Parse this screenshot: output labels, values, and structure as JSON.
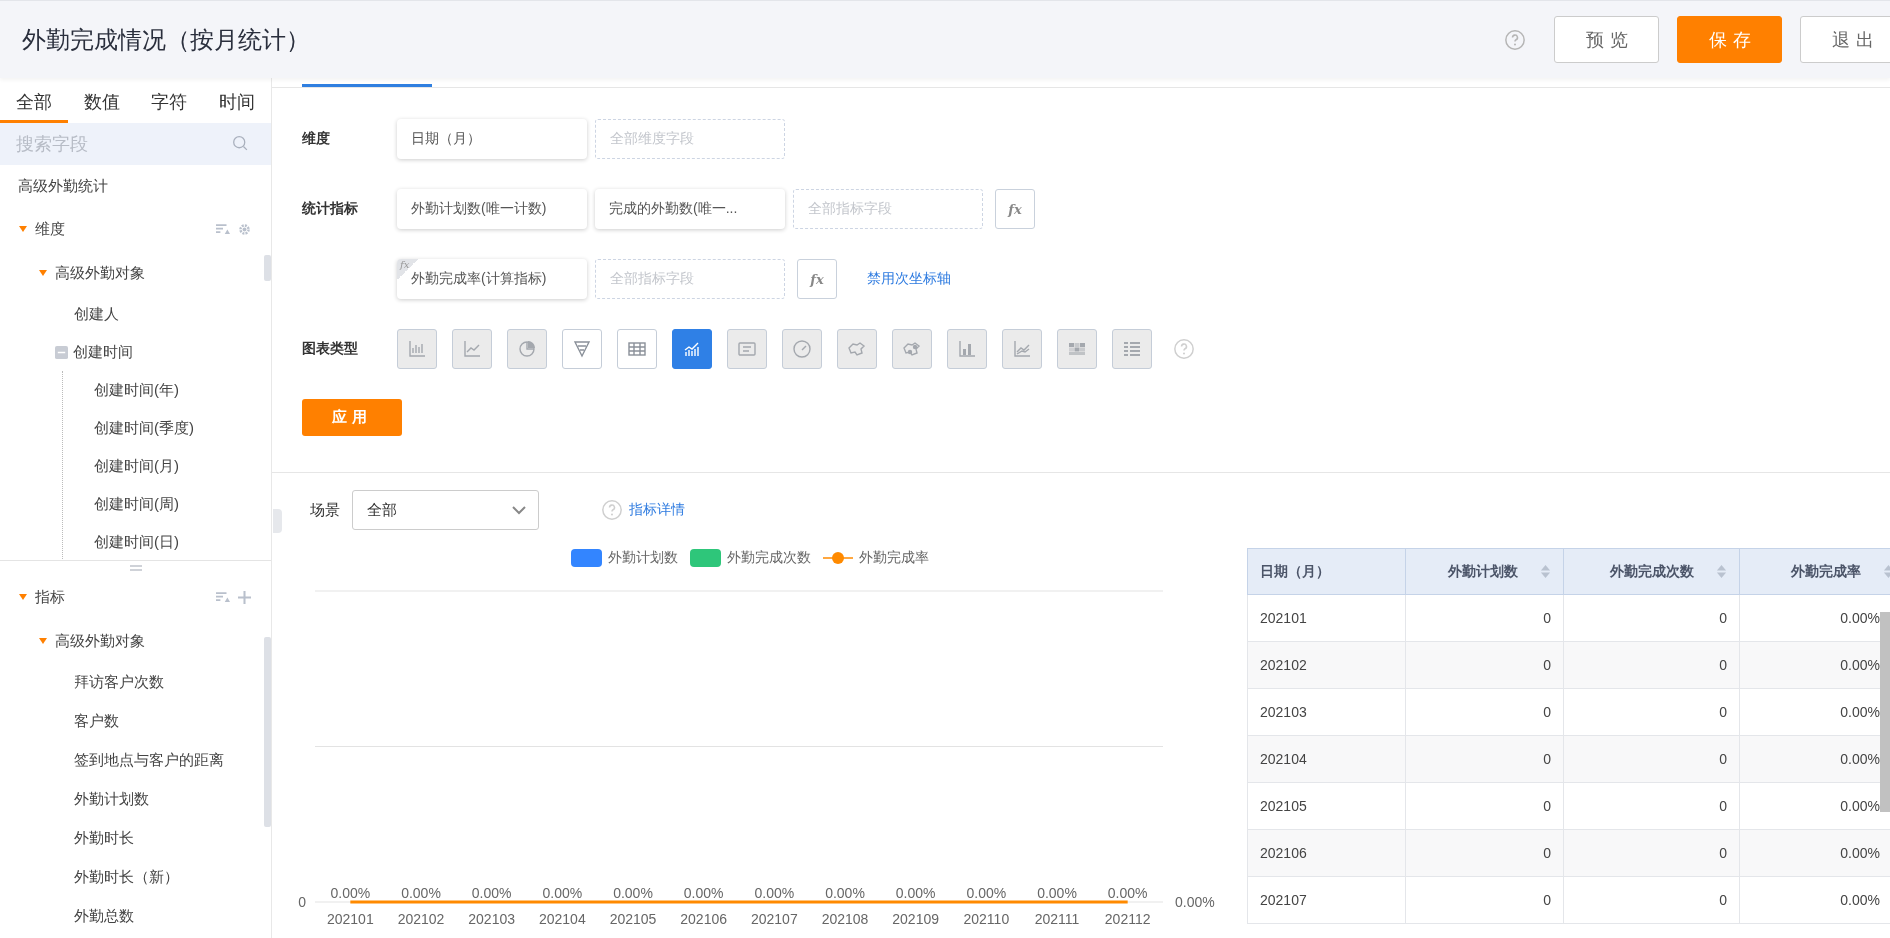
{
  "header": {
    "title": "外勤完成情况（按月统计）",
    "buttons": [
      {
        "label": "预览",
        "kind": "default"
      },
      {
        "label": "保存",
        "kind": "primary"
      },
      {
        "label": "退出",
        "kind": "default"
      }
    ]
  },
  "sidebar": {
    "tabs": [
      {
        "label": "全部",
        "selected": true
      },
      {
        "label": "数值",
        "selected": false
      },
      {
        "label": "字符",
        "selected": false
      },
      {
        "label": "时间",
        "selected": false
      }
    ],
    "search": {
      "placeholder": "搜索字段"
    },
    "dimension_panel": {
      "title": "高级外勤统计",
      "tree": [
        {
          "label": "维度",
          "expanded": true,
          "children": [
            {
              "label": "高级外勤对象",
              "expanded": true,
              "children": [
                {
                  "label": "创建人"
                },
                {
                  "label": "创建时间",
                  "expanded": true,
                  "children": [
                    {
                      "label": "创建时间(年)"
                    },
                    {
                      "label": "创建时间(季度)"
                    },
                    {
                      "label": "创建时间(月)"
                    },
                    {
                      "label": "创建时间(周)"
                    },
                    {
                      "label": "创建时间(日)"
                    }
                  ]
                }
              ]
            }
          ]
        }
      ]
    },
    "metric_panel": {
      "tree": [
        {
          "label": "指标",
          "expanded": true,
          "children": [
            {
              "label": "高级外勤对象",
              "expanded": true,
              "children": [
                {
                  "label": "拜访客户次数"
                },
                {
                  "label": "客户数"
                },
                {
                  "label": "签到地点与客户的距离"
                },
                {
                  "label": "外勤计划数"
                },
                {
                  "label": "外勤时长"
                },
                {
                  "label": "外勤时长（新）"
                },
                {
                  "label": "外勤总数"
                }
              ]
            }
          ]
        }
      ]
    }
  },
  "config": {
    "rows": [
      {
        "label": "维度",
        "items": [
          {
            "kind": "chip",
            "text": "日期（月）"
          },
          {
            "kind": "drop",
            "placeholder": "全部维度字段"
          }
        ]
      },
      {
        "label": "统计指标",
        "items": [
          {
            "kind": "chip",
            "text": "外勤计划数(唯一计数)"
          },
          {
            "kind": "chip",
            "text": "完成的外勤数(唯一..."
          },
          {
            "kind": "drop",
            "placeholder": "全部指标字段"
          },
          {
            "kind": "fx",
            "text": "fx"
          }
        ]
      },
      {
        "items": [
          {
            "kind": "chip",
            "text": "外勤完成率(计算指标)",
            "badge": "fx"
          },
          {
            "kind": "drop",
            "placeholder": "全部指标字段"
          },
          {
            "kind": "fx",
            "text": "fx"
          },
          {
            "kind": "link",
            "text": "禁用次坐标轴"
          }
        ]
      }
    ],
    "chart_type": {
      "label": "图表类型",
      "options": [
        {
          "selected": false,
          "disabled": true
        },
        {
          "selected": false,
          "disabled": true
        },
        {
          "selected": false,
          "disabled": true
        },
        {
          "selected": false,
          "disabled": false
        },
        {
          "selected": false,
          "disabled": false
        },
        {
          "selected": true,
          "disabled": false
        },
        {
          "selected": false,
          "disabled": true
        },
        {
          "selected": false,
          "disabled": true
        },
        {
          "selected": false,
          "disabled": true
        },
        {
          "selected": false,
          "disabled": true
        },
        {
          "selected": false,
          "disabled": true
        },
        {
          "selected": false,
          "disabled": true
        },
        {
          "selected": false,
          "disabled": true
        },
        {
          "selected": false,
          "disabled": true
        }
      ]
    },
    "apply_button": "应用"
  },
  "results": {
    "scene": {
      "label": "场景",
      "value": "全部"
    },
    "details_link": "指标详情",
    "chart": {
      "legend": [
        {
          "name": "外勤计划数",
          "color": "#3385ff",
          "kind": "bar"
        },
        {
          "name": "外勤完成次数",
          "color": "#2ec67a",
          "kind": "bar"
        },
        {
          "name": "外勤完成率",
          "color": "#ff8a00",
          "kind": "line"
        }
      ],
      "left_axis_label": "0",
      "right_axis_label": "0.00%",
      "x_labels": [
        "202101",
        "202102",
        "202103",
        "202104",
        "202105",
        "202106",
        "202107",
        "202108",
        "202109",
        "202110",
        "202111",
        "202112"
      ],
      "point_labels": [
        "0.00%",
        "0.00%",
        "0.00%",
        "0.00%",
        "0.00%",
        "0.00%",
        "0.00%",
        "0.00%",
        "0.00%",
        "0.00%",
        "0.00%",
        "0.00%"
      ]
    },
    "table": {
      "columns": [
        {
          "label": "日期（月）",
          "sortable": false
        },
        {
          "label": "外勤计划数",
          "sortable": true
        },
        {
          "label": "外勤完成次数",
          "sortable": true
        },
        {
          "label": "外勤完成率",
          "sortable": true
        }
      ],
      "rows": [
        [
          "202101",
          "0",
          "0",
          "0.00%"
        ],
        [
          "202102",
          "0",
          "0",
          "0.00%"
        ],
        [
          "202103",
          "0",
          "0",
          "0.00%"
        ],
        [
          "202104",
          "0",
          "0",
          "0.00%"
        ],
        [
          "202105",
          "0",
          "0",
          "0.00%"
        ],
        [
          "202106",
          "0",
          "0",
          "0.00%"
        ],
        [
          "202107",
          "0",
          "0",
          "0.00%"
        ]
      ]
    }
  }
}
